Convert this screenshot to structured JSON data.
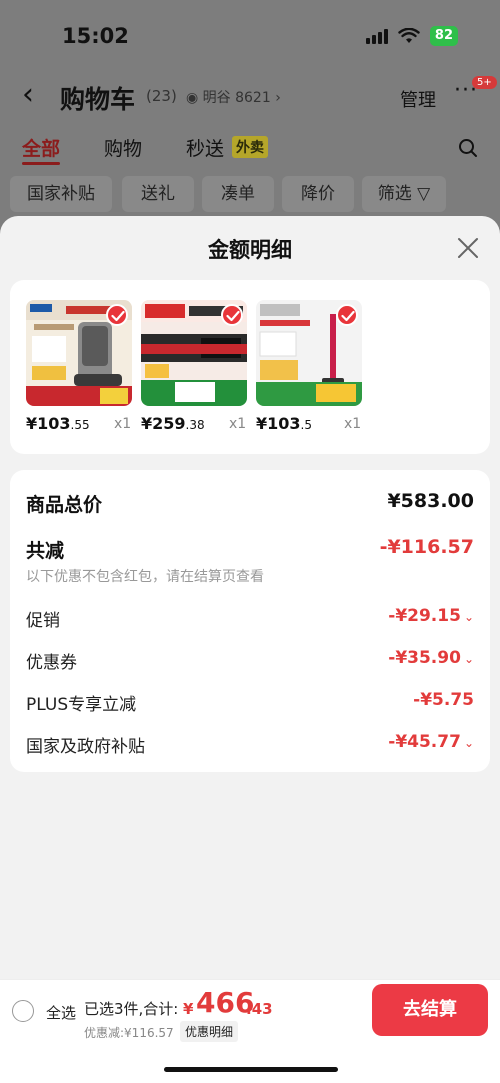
{
  "status": {
    "time": "15:02",
    "battery": "82"
  },
  "nav": {
    "title": "购物车",
    "count": "(23)",
    "location": "明谷 8621 ›",
    "manage": "管理",
    "more": "···",
    "badge": "5+"
  },
  "tabs": [
    {
      "label": "全部"
    },
    {
      "label": "购物"
    },
    {
      "label": "秒送"
    }
  ],
  "tab_tag": "外卖",
  "chips": [
    {
      "label": "国家补贴"
    },
    {
      "label": "送礼"
    },
    {
      "label": "凑单"
    },
    {
      "label": "降价"
    },
    {
      "label": "筛选 ▽"
    }
  ],
  "sheet": {
    "title": "金额明细"
  },
  "products": [
    {
      "price_main": "¥103",
      "price_dec": ".55",
      "qty": "x1"
    },
    {
      "price_main": "¥259",
      "price_dec": ".38",
      "qty": "x1"
    },
    {
      "price_main": "¥103",
      "price_dec": ".5",
      "qty": "x1"
    }
  ],
  "summary": {
    "total_label": "商品总价",
    "total_value": "¥583.00",
    "reduce_label": "共减",
    "reduce_value": "-¥116.57",
    "note": "以下优惠不包含红包，请在结算页查看",
    "promo_label": "促销",
    "promo_value": "-¥29.15",
    "coupon_label": "优惠券",
    "coupon_value": "-¥35.90",
    "plus_label": "PLUS专享立减",
    "plus_value": "-¥5.75",
    "subsidy_label": "国家及政府补贴",
    "subsidy_value": "-¥45.77"
  },
  "bottom": {
    "select_all": "全选",
    "selected": "已选3件,合计:",
    "currency": "¥",
    "total_int": "466",
    "total_dec": ".43",
    "discount": "优惠减:¥116.57",
    "detail": "优惠明细",
    "checkout": "去结算"
  },
  "colors": {
    "accent": "#e23b3b",
    "button": "#ec3a45",
    "sheet_bg": "#f2f2f2"
  }
}
